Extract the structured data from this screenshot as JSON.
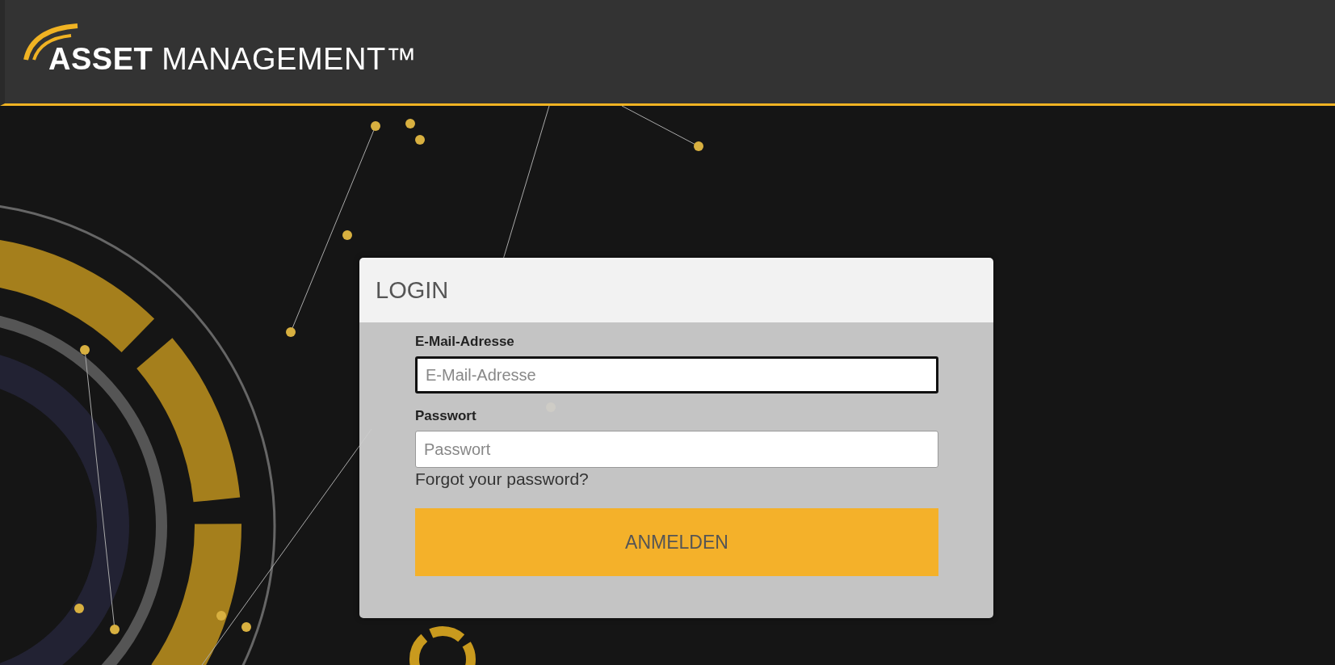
{
  "header": {
    "logo_text": "**ASSET** MANAGEMENT™"
  },
  "login": {
    "title": "LOGIN",
    "fields": [
      {
        "label": "E-Mail-Adresse",
        "placeholder": "E-Mail-Adresse",
        "focused": true
      },
      {
        "label": "Passwort",
        "placeholder": "Passwort",
        "focused": false
      }
    ],
    "forgot_link": "Forgot your password?",
    "submit": "ANMELDEN"
  }
}
